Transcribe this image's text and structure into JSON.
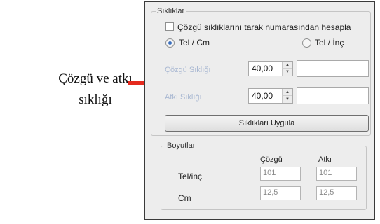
{
  "annotation": {
    "caption_line1": "Çözgü ve atkı",
    "caption_line2": "sıklığı",
    "arrow_color": "#e52a1e"
  },
  "panel": {
    "group_title": "Sıklıklar",
    "checkbox_label": "Çözgü sıklıklarını tarak numarasından hesapla",
    "checkbox_checked": false,
    "radio_cm_label": "Tel / Cm",
    "radio_cm_selected": true,
    "radio_inch_label": "Tel / İnç",
    "radio_inch_selected": false,
    "warp_density_label": "Çözgü Sıklığı",
    "warp_density_value": "40,00",
    "weft_density_label": "Atkı Sıklığı",
    "weft_density_value": "40,00",
    "apply_button_label": "Sıklıkları Uygula"
  },
  "dimensions": {
    "group_title": "Boyutlar",
    "col_warp": "Çözgü",
    "col_weft": "Atkı",
    "row_inch_label": "Tel/inç",
    "row_inch_warp": "101",
    "row_inch_weft": "101",
    "row_cm_label": "Cm",
    "row_cm_warp": "12,5",
    "row_cm_weft": "12,5"
  },
  "colors": {
    "disabled_label": "#a9b8d2",
    "radio_dot": "#3b6fbd",
    "panel_bg": "#ededed"
  }
}
